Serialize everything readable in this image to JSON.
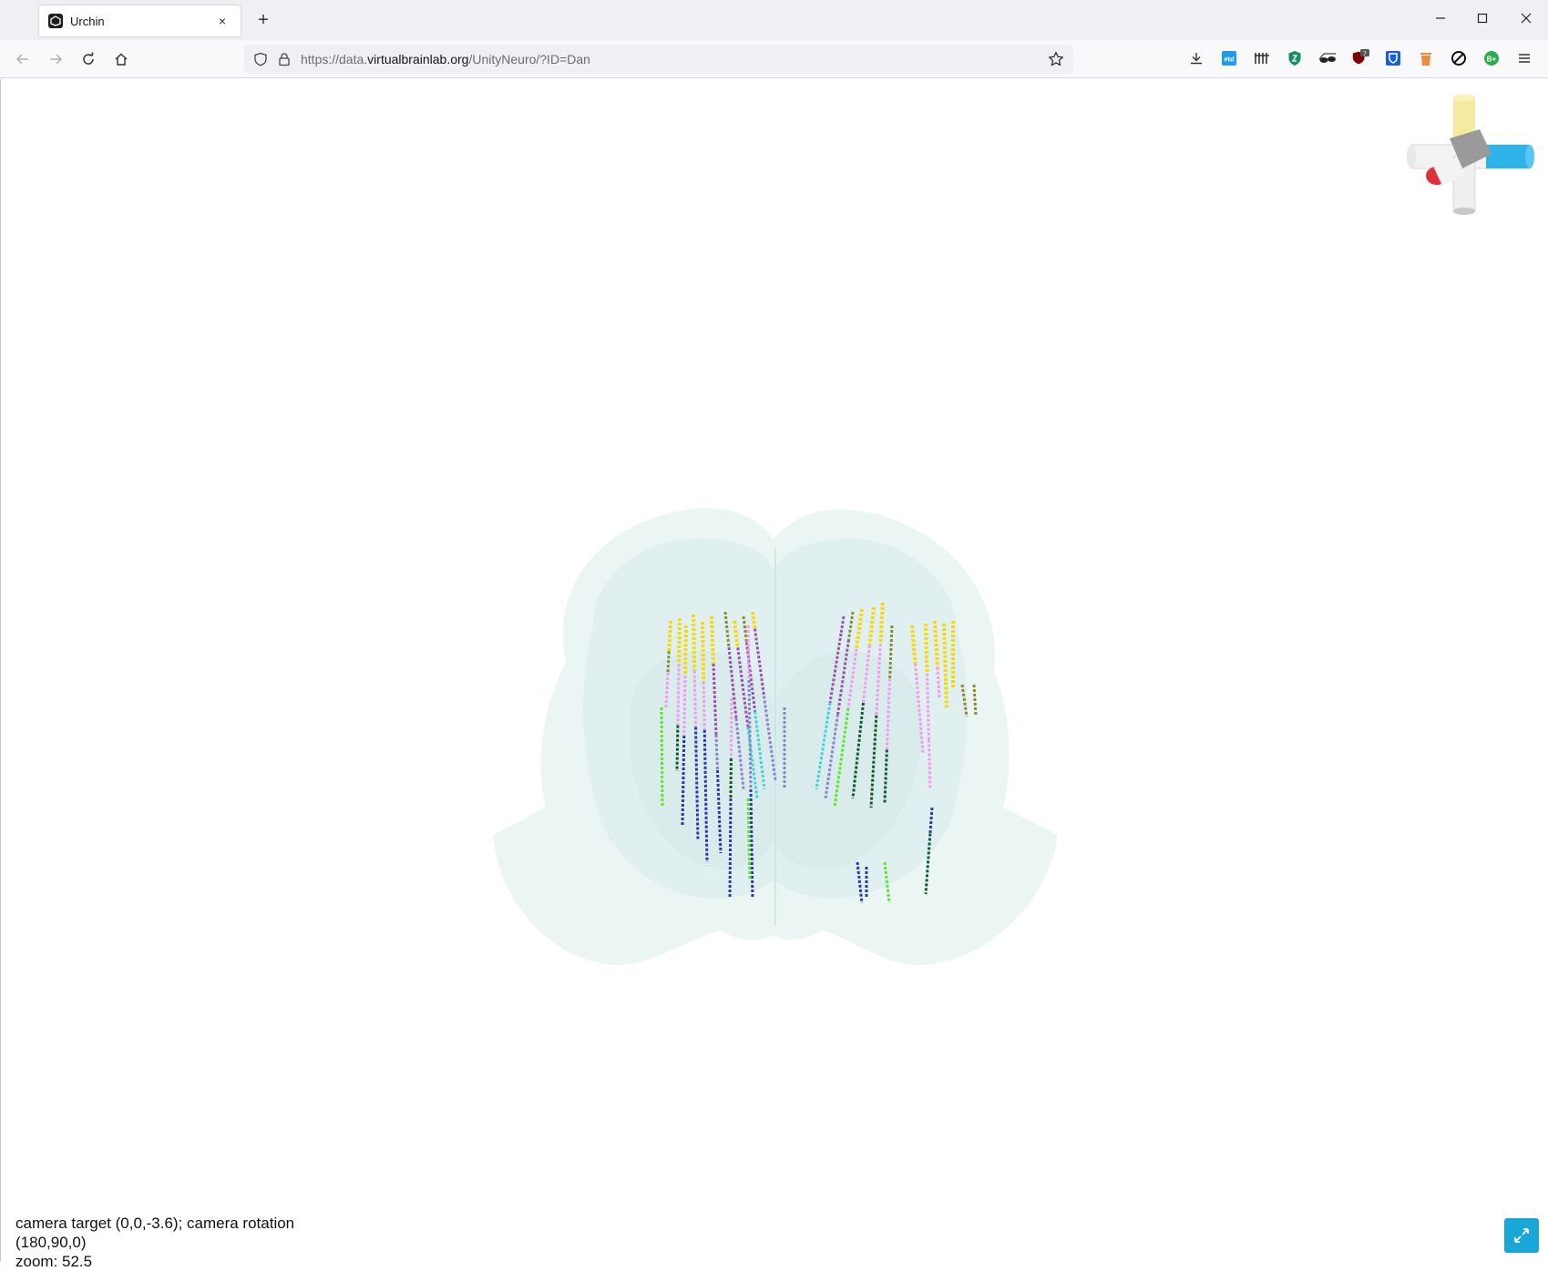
{
  "browser": {
    "tab": {
      "title": "Urchin",
      "close": "×"
    },
    "newtab": "+",
    "url": {
      "prefix": "https://data.",
      "domain": "virtualbrainlab.org",
      "path": "/UnityNeuro/?ID=Dan"
    },
    "extension_badge": "7",
    "extensions": [
      "download-icon",
      "td-icon",
      "bars-icon",
      "shield-icon",
      "sunglasses-icon",
      "ublock-icon",
      "bitwarden-icon",
      "trash-icon",
      "block-icon",
      "badge-icon",
      "menu-icon"
    ]
  },
  "viewer": {
    "status_line1": "camera target (0,0,-3.6); camera rotation",
    "status_line2": "(180,90,0)",
    "status_line3": "zoom: 52.5"
  },
  "colors": {
    "accent": "#19a7d7",
    "brain": "#e6f2f1",
    "yellow": "#f5d90a",
    "olive": "#8a8a2a",
    "purple": "#9b4fb0",
    "pink": "#f39af0",
    "slate": "#8a84d0",
    "cyan": "#3fd3de",
    "dgreen": "#0f5a2a",
    "lgreen": "#58e82a",
    "blue": "#2c36b0"
  }
}
